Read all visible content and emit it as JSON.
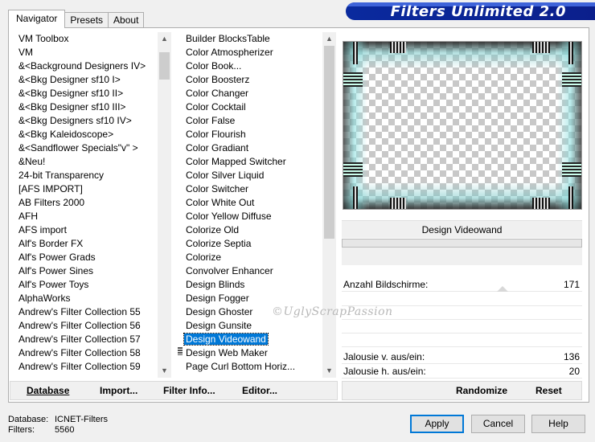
{
  "tabs": [
    "Navigator",
    "Presets",
    "About"
  ],
  "app_title": "Filters Unlimited 2.0",
  "categories": [
    "VM Toolbox",
    "VM",
    "&<Background Designers IV>",
    "&<Bkg Designer sf10 I>",
    "&<Bkg Designer sf10 II>",
    "&<Bkg Designer sf10 III>",
    "&<Bkg Designers sf10 IV>",
    "&<Bkg Kaleidoscope>",
    "&<Sandflower Specials\"v\" >",
    "&Neu!",
    "24-bit Transparency",
    "[AFS IMPORT]",
    "AB Filters 2000",
    "AFH",
    "AFS import",
    "Alf's Border FX",
    "Alf's Power Grads",
    "Alf's Power Sines",
    "Alf's Power Toys",
    "AlphaWorks",
    "Andrew's Filter Collection 55",
    "Andrew's Filter Collection 56",
    "Andrew's Filter Collection 57",
    "Andrew's Filter Collection 58",
    "Andrew's Filter Collection 59"
  ],
  "filters": [
    "Builder BlocksTable",
    "Color Atmospherizer",
    "Color Book...",
    "Color Boosterz",
    "Color Changer",
    "Color Cocktail",
    "Color False",
    "Color Flourish",
    "Color Gradiant",
    "Color Mapped Switcher",
    "Color Silver Liquid",
    "Color Switcher",
    "Color White Out",
    "Color Yellow Diffuse",
    "Colorize Old",
    "Colorize Septia",
    "Colorize",
    "Convolver Enhancer",
    "Design Blinds",
    "Design Fogger",
    "Design Ghoster",
    "Design Gunsite",
    "Design Videowand",
    "Design Web Maker",
    "Page Curl Bottom Horiz..."
  ],
  "selected_filter": "Design Videowand",
  "filter_name_display": "Design Videowand",
  "params": [
    {
      "label": "Anzahl Bildschirme:",
      "value": "171"
    },
    {
      "label": "Jalousie v. aus/ein:",
      "value": "136"
    },
    {
      "label": "Jalousie h. aus/ein:",
      "value": "20"
    }
  ],
  "watermark": "©UglyScrapPassion",
  "toolbar": {
    "database": "Database",
    "import": "Import...",
    "filter_info": "Filter Info...",
    "editor": "Editor...",
    "randomize": "Randomize",
    "reset": "Reset"
  },
  "footer": {
    "database_label": "Database:",
    "database_value": "ICNET-Filters",
    "filters_label": "Filters:",
    "filters_value": "5560"
  },
  "buttons": {
    "apply": "Apply",
    "cancel": "Cancel",
    "help": "Help"
  },
  "colors": {
    "accent": "#0078d7",
    "banner": "#0b1f8c"
  }
}
